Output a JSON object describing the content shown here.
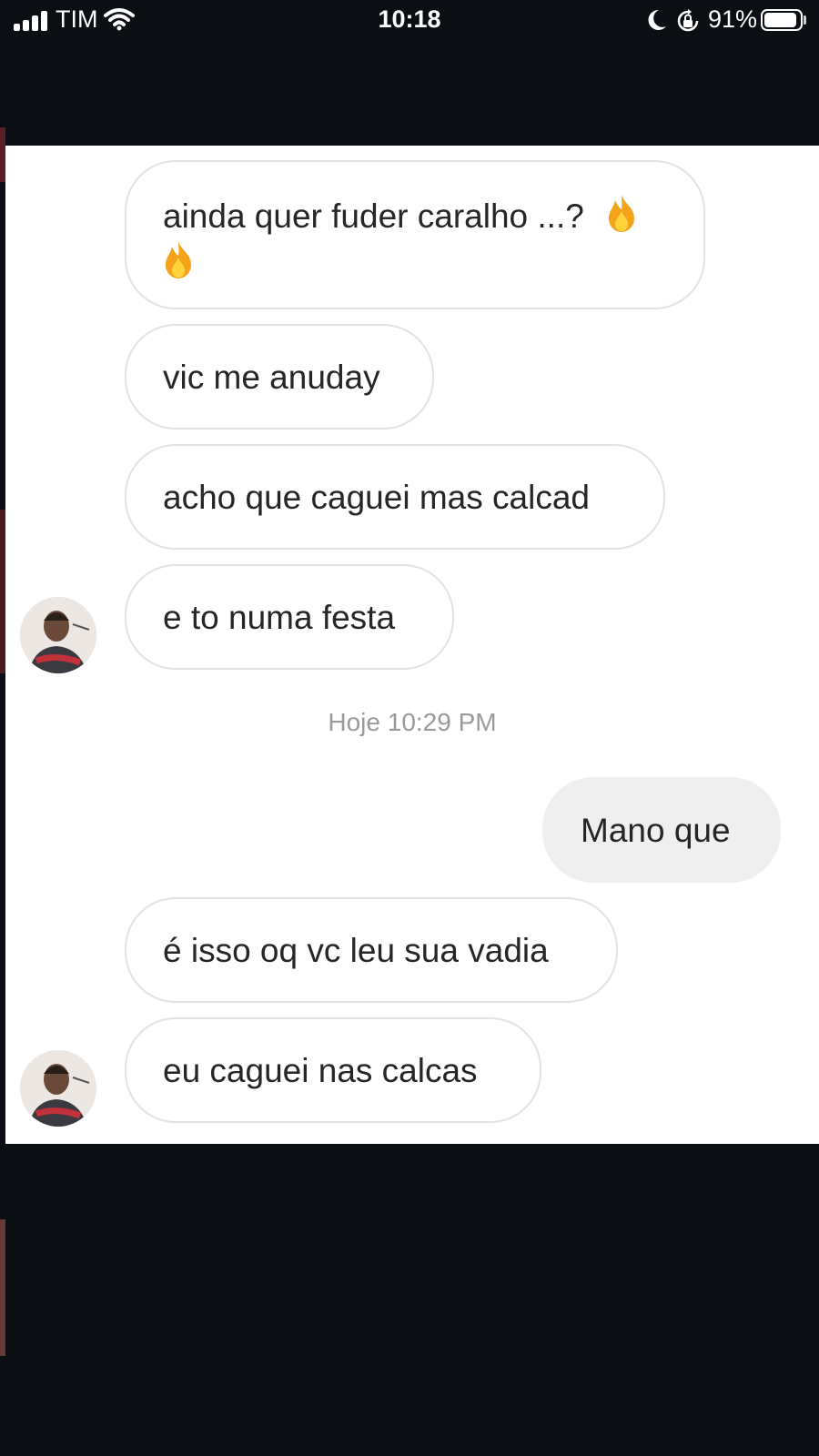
{
  "status_bar": {
    "carrier": "TIM",
    "time": "10:18",
    "battery_percent": "91%",
    "battery_level": 0.91,
    "icons": [
      "signal-icon",
      "wifi-icon",
      "do-not-disturb-moon-icon",
      "rotation-lock-icon",
      "battery-icon"
    ]
  },
  "chat": {
    "timestamp": "Hoje 10:29 PM",
    "messages": [
      {
        "from": "them",
        "text": "ainda quer fuder caralho ...?",
        "emoji": "fire-emoji-x2"
      },
      {
        "from": "them",
        "text": "vic me anuday"
      },
      {
        "from": "them",
        "text": "acho que caguei mas calcad"
      },
      {
        "from": "them",
        "text": "e to numa festa"
      },
      {
        "from": "me",
        "text": "Mano que"
      },
      {
        "from": "them",
        "text": "é isso oq vc leu sua vadia"
      },
      {
        "from": "them",
        "text": "eu caguei nas calcas"
      }
    ]
  },
  "colors": {
    "background": "#0b0f14",
    "chat_background": "#ffffff",
    "incoming_border": "#e3e3e3",
    "outgoing_bubble": "#efefef",
    "text": "#262626",
    "timestamp": "#9a9a9a"
  }
}
